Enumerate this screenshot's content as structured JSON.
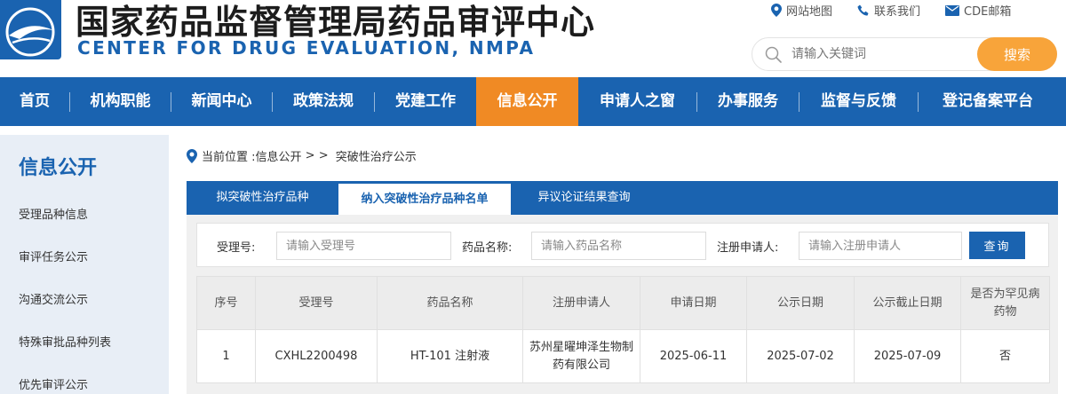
{
  "header": {
    "title_cn": "国家药品监督管理局药品审评中心",
    "title_en": "CENTER FOR DRUG EVALUATION, NMPA",
    "top_links": [
      {
        "label": "网站地图",
        "icon": "location-pin-icon"
      },
      {
        "label": "联系我们",
        "icon": "phone-icon"
      },
      {
        "label": "CDE邮箱",
        "icon": "mail-icon"
      }
    ],
    "search": {
      "placeholder": "请输入关键词",
      "button": "搜索"
    }
  },
  "nav": {
    "items": [
      "首页",
      "机构职能",
      "新闻中心",
      "政策法规",
      "党建工作",
      "信息公开",
      "申请人之窗",
      "办事服务",
      "监督与反馈",
      "登记备案平台"
    ],
    "active": "信息公开"
  },
  "sidebar": {
    "title": "信息公开",
    "items": [
      "受理品种信息",
      "审评任务公示",
      "沟通交流公示",
      "特殊审批品种列表",
      "优先审评公示"
    ]
  },
  "breadcrumb": {
    "prefix": "当前位置 : ",
    "link": "信息公开",
    "sep": " > > ",
    "current": "突破性治疗公示"
  },
  "tabs": {
    "items": [
      "拟突破性治疗品种",
      "纳入突破性治疗品种名单",
      "异议论证结果查询"
    ],
    "active": "纳入突破性治疗品种名单"
  },
  "filter": {
    "fields": [
      {
        "label": "受理号:",
        "placeholder": "请输入受理号"
      },
      {
        "label": "药品名称:",
        "placeholder": "请输入药品名称"
      },
      {
        "label": "注册申请人:",
        "placeholder": "请输入注册申请人"
      }
    ],
    "query_button": "查询"
  },
  "table": {
    "headers": [
      "序号",
      "受理号",
      "药品名称",
      "注册申请人",
      "申请日期",
      "公示日期",
      "公示截止日期",
      "是否为罕见病药物"
    ],
    "rows": [
      [
        "1",
        "CXHL2200498",
        "HT-101 注射液",
        "苏州星曜坤泽生物制药有限公司",
        "2025-06-11",
        "2025-07-02",
        "2025-07-09",
        "否"
      ]
    ]
  },
  "colors": {
    "primary_blue": "#1a63b0",
    "active_orange": "#f08a24",
    "search_button": "#f8a43a",
    "sidebar_bg": "#e8eef6"
  }
}
